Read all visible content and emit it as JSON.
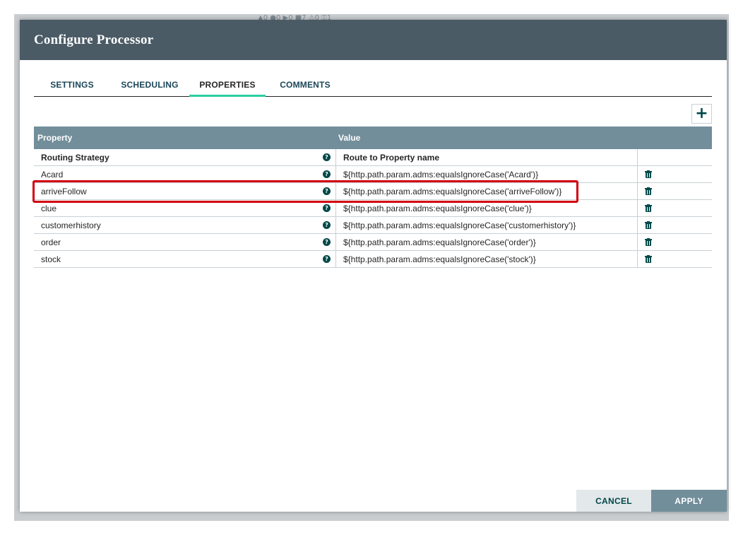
{
  "dialog": {
    "title": "Configure Processor",
    "tabs": [
      {
        "label": "SETTINGS",
        "active": false
      },
      {
        "label": "SCHEDULING",
        "active": false
      },
      {
        "label": "PROPERTIES",
        "active": true
      },
      {
        "label": "COMMENTS",
        "active": false
      }
    ],
    "add_icon": "plus-icon",
    "grid": {
      "headers": {
        "property": "Property",
        "value": "Value"
      },
      "rows": [
        {
          "property": "Routing Strategy",
          "value": "Route to Property name",
          "deletable": false
        },
        {
          "property": "Acard",
          "value": "${http.path.param.adms:equalsIgnoreCase('Acard')}",
          "deletable": true
        },
        {
          "property": "arriveFollow",
          "value": "${http.path.param.adms:equalsIgnoreCase('arriveFollow')}",
          "deletable": true,
          "highlighted": true
        },
        {
          "property": "clue",
          "value": "${http.path.param.adms:equalsIgnoreCase('clue')}",
          "deletable": true
        },
        {
          "property": "customerhistory",
          "value": "${http.path.param.adms:equalsIgnoreCase('customerhistory')}",
          "deletable": true
        },
        {
          "property": "order",
          "value": "${http.path.param.adms:equalsIgnoreCase('order')}",
          "deletable": true
        },
        {
          "property": "stock",
          "value": "${http.path.param.adms:equalsIgnoreCase('stock')}",
          "deletable": true
        }
      ]
    },
    "buttons": {
      "cancel": "CANCEL",
      "apply": "APPLY"
    },
    "colors": {
      "header": "#4a5b66",
      "grid_header": "#728e9b",
      "active_tab": "#2bcfa1",
      "highlight": "#d2000d",
      "icon": "#004849"
    }
  }
}
